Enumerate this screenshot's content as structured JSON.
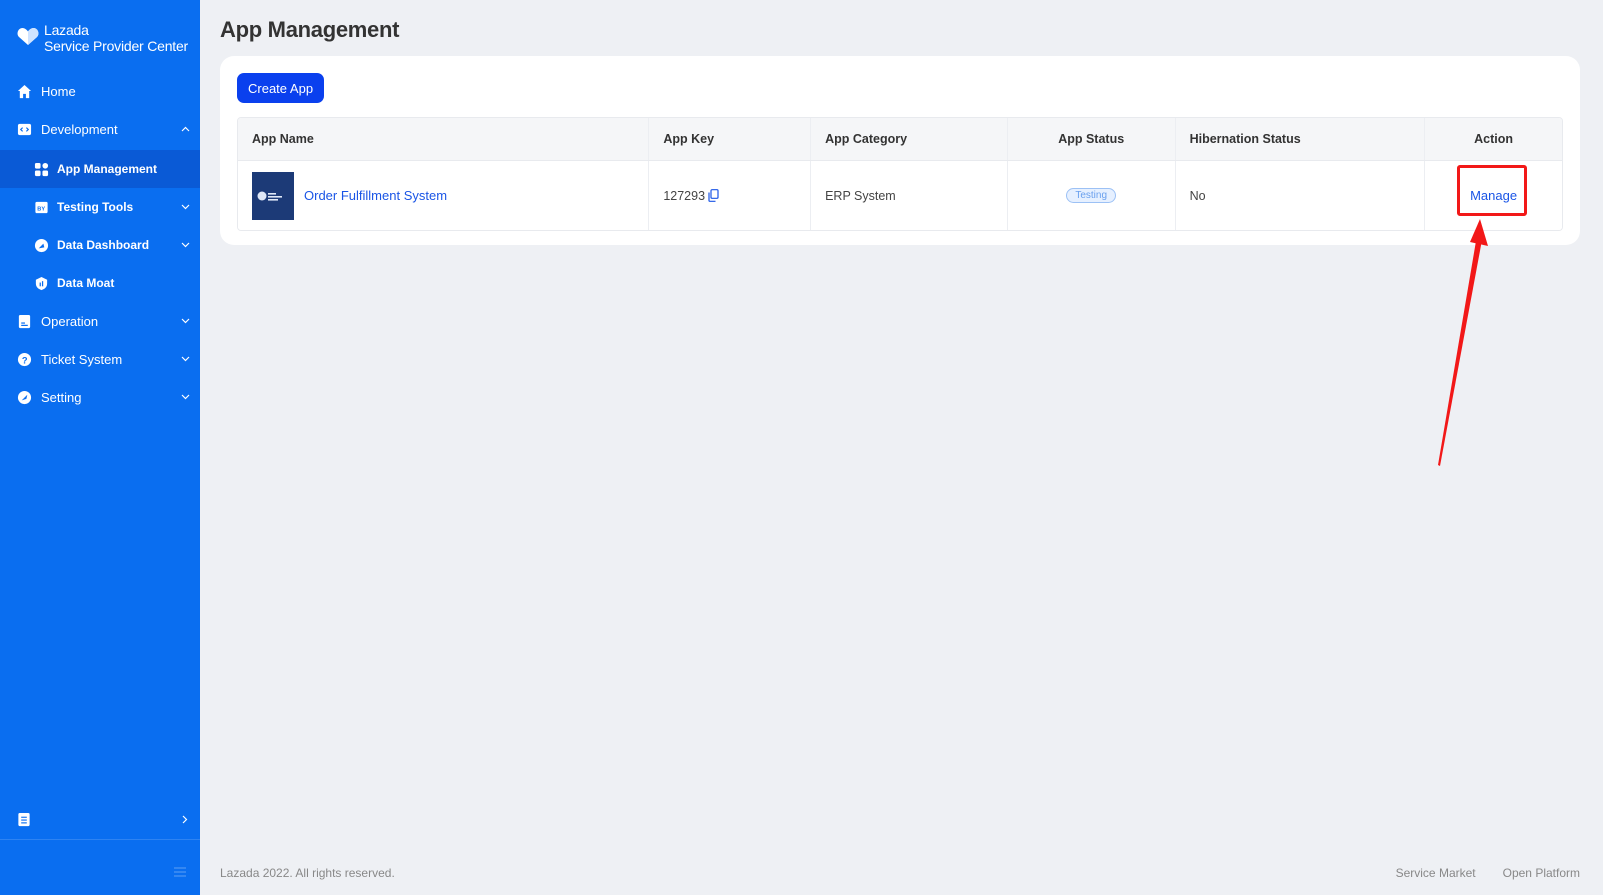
{
  "brand": {
    "line1": "Lazada",
    "line2": "Service Provider Center"
  },
  "sidebar": {
    "items": [
      {
        "label": "Home",
        "icon": "home-icon"
      },
      {
        "label": "Development",
        "icon": "code-icon",
        "chevron": "up"
      },
      {
        "label": "App Management",
        "icon": "apps-icon",
        "active": true
      },
      {
        "label": "Testing Tools",
        "icon": "testing-icon",
        "chevron": "down"
      },
      {
        "label": "Data Dashboard",
        "icon": "dashboard-icon",
        "chevron": "down"
      },
      {
        "label": "Data Moat",
        "icon": "shield-icon"
      },
      {
        "label": "Operation",
        "icon": "document-icon",
        "chevron": "down"
      },
      {
        "label": "Ticket System",
        "icon": "question-icon",
        "chevron": "down"
      },
      {
        "label": "Setting",
        "icon": "compass-icon",
        "chevron": "down"
      }
    ]
  },
  "page": {
    "title": "App Management"
  },
  "toolbar": {
    "create_label": "Create App"
  },
  "table": {
    "headers": [
      "App Name",
      "App Key",
      "App Category",
      "App Status",
      "Hibernation Status",
      "Action"
    ],
    "rows": [
      {
        "app_name": "Order Fulfillment System",
        "app_key": "127293",
        "app_category": "ERP System",
        "app_status": "Testing",
        "hibernation_status": "No",
        "action": "Manage"
      }
    ]
  },
  "footer": {
    "copyright": "Lazada 2022. All rights reserved.",
    "links": [
      "Service Market",
      "Open Platform"
    ]
  },
  "colors": {
    "sidebar_bg": "#0a6ef0",
    "primary_button": "#0a40ee",
    "link": "#1a55e6",
    "highlight": "#f21818"
  }
}
